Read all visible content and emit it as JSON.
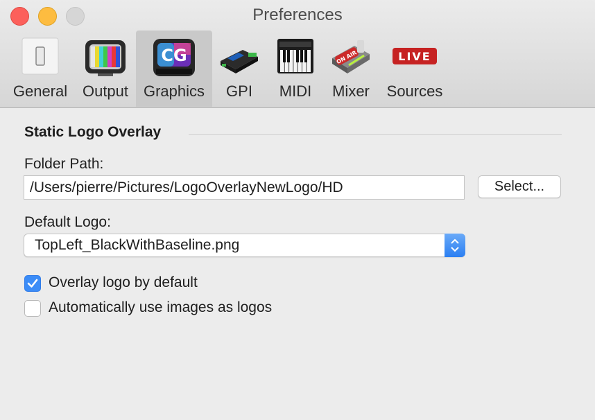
{
  "window": {
    "title": "Preferences"
  },
  "toolbar": {
    "tabs": [
      {
        "label": "General",
        "icon": "switch-icon"
      },
      {
        "label": "Output",
        "icon": "tv-color-bars-icon"
      },
      {
        "label": "Graphics",
        "icon": "cg-badge-icon",
        "selected": true,
        "icon_text": "CG"
      },
      {
        "label": "GPI",
        "icon": "gpi-device-icon"
      },
      {
        "label": "MIDI",
        "icon": "piano-keyboard-icon"
      },
      {
        "label": "Mixer",
        "icon": "on-air-fader-icon",
        "icon_text": "ON AIR"
      },
      {
        "label": "Sources",
        "icon": "live-badge-icon",
        "icon_text": "LIVE"
      }
    ]
  },
  "content": {
    "section_title": "Static Logo Overlay",
    "folder_path_label": "Folder Path:",
    "folder_path_value": "/Users/pierre/Pictures/LogoOverlayNewLogo/HD",
    "select_button": "Select...",
    "default_logo_label": "Default Logo:",
    "default_logo_value": "TopLeft_BlackWithBaseline.png",
    "options": [
      {
        "label": "Overlay logo by default",
        "checked": true
      },
      {
        "label": "Automatically use images as logos",
        "checked": false
      }
    ]
  },
  "colors": {
    "accent": "#3b8cf7",
    "live": "#c62222"
  }
}
